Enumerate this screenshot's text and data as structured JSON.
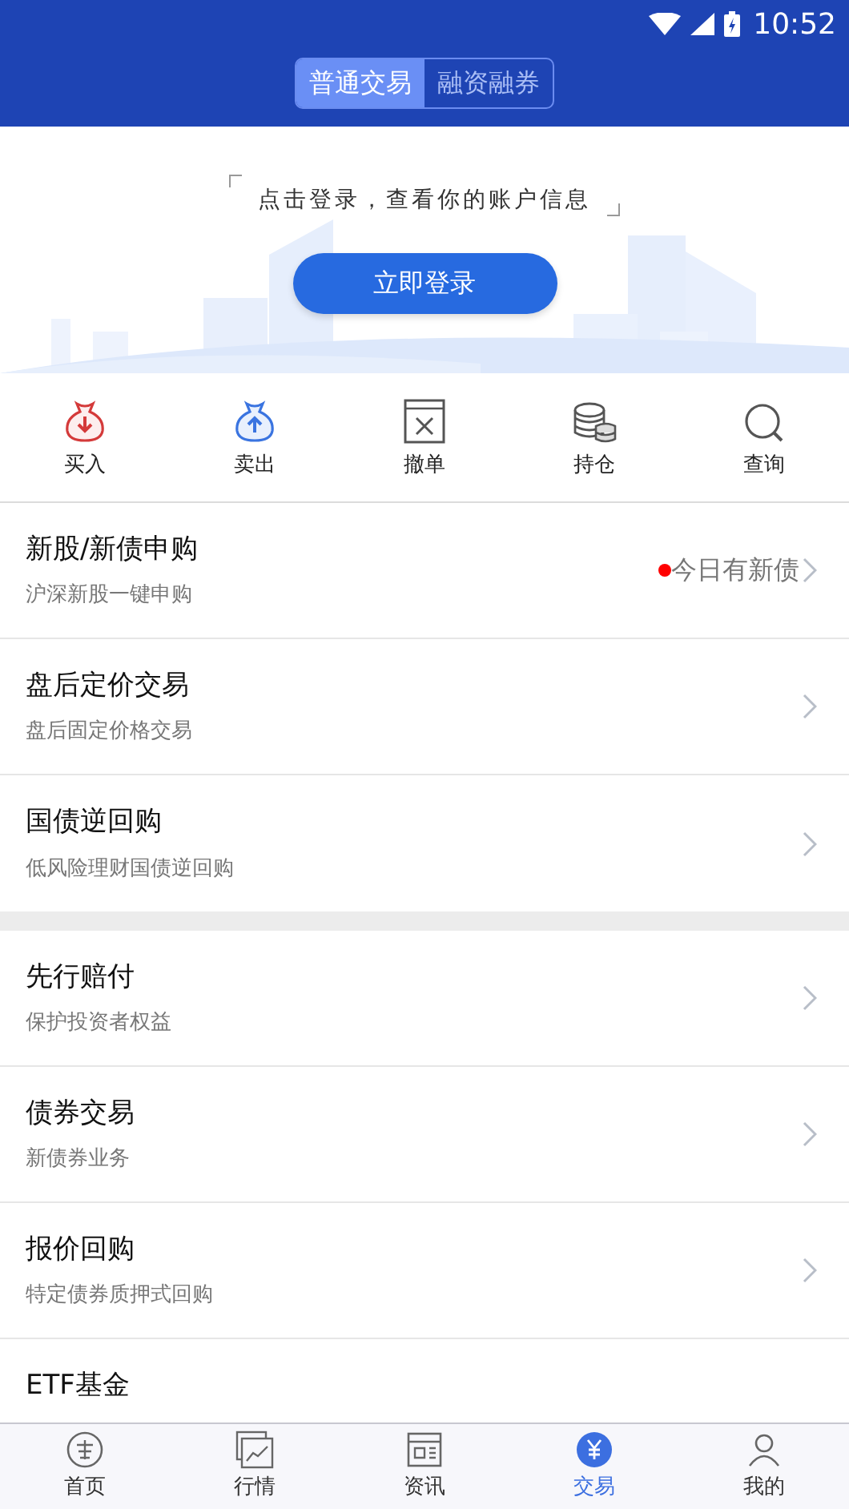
{
  "status_bar": {
    "time": "10:52"
  },
  "tabs": [
    {
      "label": "普通交易",
      "selected": true
    },
    {
      "label": "融资融券",
      "selected": false
    }
  ],
  "login": {
    "prompt": "点击登录，查看你的账户信息",
    "button": "立即登录"
  },
  "quick_actions": [
    {
      "label": "买入",
      "kind": "buy"
    },
    {
      "label": "卖出",
      "kind": "sell"
    },
    {
      "label": "撤单",
      "kind": "cancel"
    },
    {
      "label": "持仓",
      "kind": "holdings"
    },
    {
      "label": "查询",
      "kind": "query"
    }
  ],
  "sections": [
    [
      {
        "title": "新股/新债申购",
        "subtitle": "沪深新股一键申购",
        "badge": "今日有新债"
      },
      {
        "title": "盘后定价交易",
        "subtitle": "盘后固定价格交易"
      },
      {
        "title": "国债逆回购",
        "subtitle": "低风险理财国债逆回购"
      }
    ],
    [
      {
        "title": "先行赔付",
        "subtitle": "保护投资者权益"
      },
      {
        "title": "债券交易",
        "subtitle": "新债券业务"
      },
      {
        "title": "报价回购",
        "subtitle": "特定债券质押式回购"
      },
      {
        "title": "ETF基金"
      }
    ]
  ],
  "bottom_nav": [
    {
      "label": "首页",
      "kind": "home",
      "selected": false
    },
    {
      "label": "行情",
      "kind": "market",
      "selected": false
    },
    {
      "label": "资讯",
      "kind": "news",
      "selected": false
    },
    {
      "label": "交易",
      "kind": "trade",
      "selected": true
    },
    {
      "label": "我的",
      "kind": "me",
      "selected": false
    }
  ]
}
